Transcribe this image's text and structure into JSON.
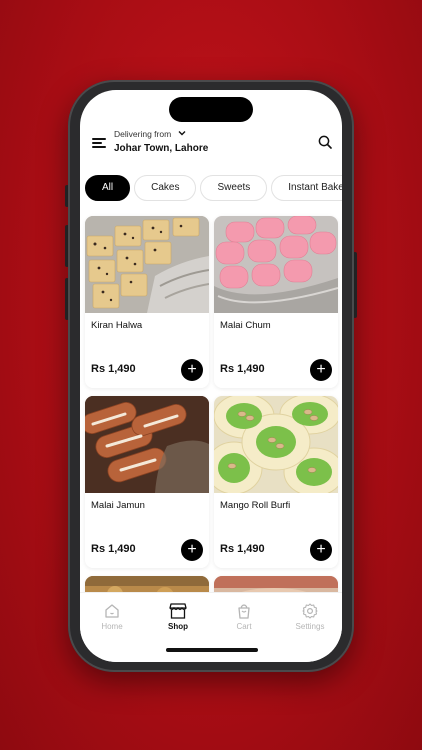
{
  "header": {
    "delivering_label": "Delivering from",
    "location": "Johar Town, Lahore"
  },
  "chips": [
    {
      "label": "All",
      "active": true
    },
    {
      "label": "Cakes",
      "active": false
    },
    {
      "label": "Sweets",
      "active": false
    },
    {
      "label": "Instant Bake",
      "active": false
    }
  ],
  "products": [
    {
      "name": "Kiran Halwa",
      "price": "Rs 1,490"
    },
    {
      "name": "Malai Chum",
      "price": "Rs 1,490"
    },
    {
      "name": "Malai Jamun",
      "price": "Rs 1,490"
    },
    {
      "name": "Mango Roll Burfi",
      "price": "Rs 1,490"
    }
  ],
  "tabbar": {
    "home": "Home",
    "shop": "Shop",
    "cart": "Cart",
    "settings": "Settings",
    "active": "shop"
  },
  "colors": {
    "background": "#b00f17",
    "accent": "#000000",
    "inactive_tab": "#b5b5b5"
  }
}
